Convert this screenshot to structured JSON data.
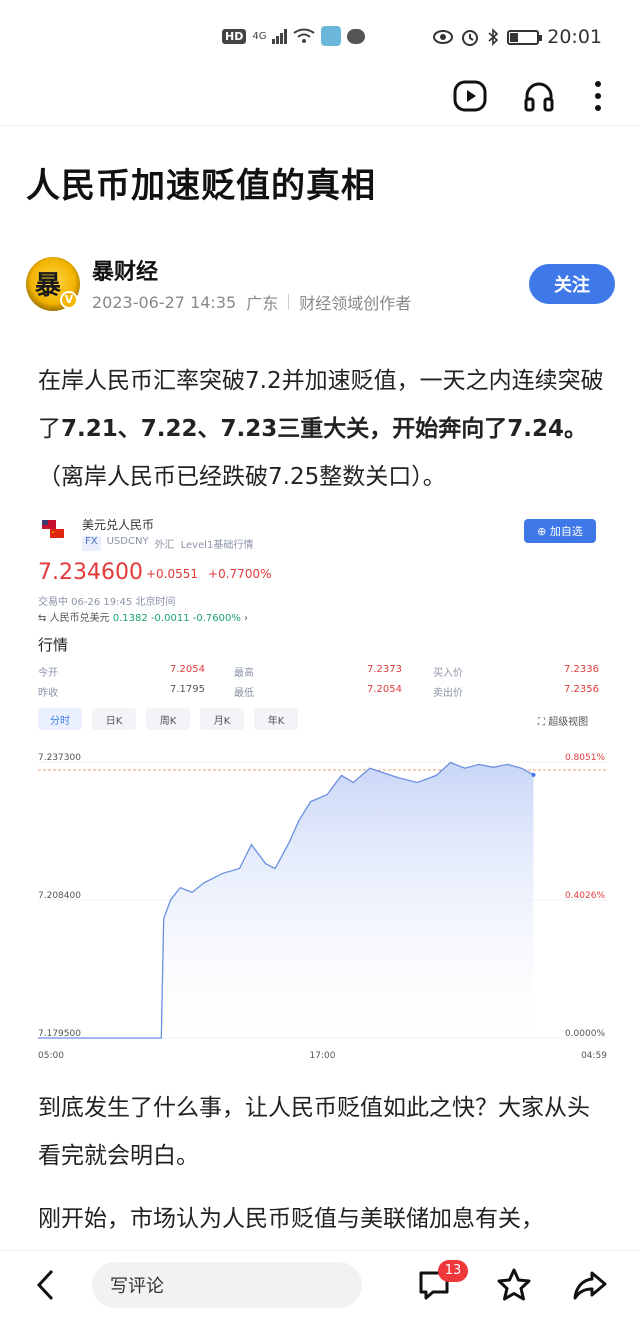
{
  "status_bar": {
    "hd": "HD",
    "network": "4G",
    "time": "20:01"
  },
  "article": {
    "title": "人民币加速贬值的真相",
    "author": {
      "name": "暴财经",
      "avatar_text": "暴",
      "verified_mark": "V",
      "date": "2023-06-27 14:35",
      "region": "广东",
      "role": "财经领域创作者"
    },
    "follow_label": "关注",
    "para1_prefix": "在岸人民币汇率突破7.2并加速贬值，一天之内连续突破了",
    "para1_bold": "7.21、7.22、7.23三重大关，开始奔向了7.24。",
    "para1_suffix": "（离岸人民币已经跌破7.25整数关口）。",
    "para2": "到底发生了什么事，让人民币贬值如此之快？大家从头看完就会明白。",
    "para3": "刚开始，市场认为人民币贬值与美联储加息有关，"
  },
  "quote": {
    "name": "美元兑人民币",
    "market": "FX",
    "code": "USDCNY",
    "type": "外汇",
    "level": "Level1基础行情",
    "add_label": "⊕ 加自选",
    "price": "7.234600",
    "change": "+0.0551",
    "change_pct": "+0.7700%",
    "time": "交易中 06-26 19:45 北京时间",
    "cny_label": "人民币兑美元",
    "cny_price": "0.1382",
    "cny_change": "-0.0011",
    "cny_pct": "-0.7600%",
    "section": "行情",
    "stats": {
      "open_label": "今开",
      "open": "7.2054",
      "high_label": "最高",
      "high": "7.2373",
      "buy_label": "买入价",
      "buy": "7.2336",
      "prev_label": "昨收",
      "prev": "7.1795",
      "low_label": "最低",
      "low": "7.2054",
      "sell_label": "卖出价",
      "sell": "7.2356"
    },
    "tabs": [
      "分时",
      "日K",
      "周K",
      "月K",
      "年K"
    ],
    "active_tab": "分时",
    "full_view": "超级视图"
  },
  "chart_data": {
    "type": "area",
    "title": "",
    "y_ticks": [
      "7.237300",
      "7.208400",
      "7.179500"
    ],
    "right_ticks": [
      "0.8051%",
      "0.4026%",
      "0.0000%"
    ],
    "x_ticks": [
      "05:00",
      "17:00",
      "04:59"
    ],
    "ylim": [
      7.1795,
      7.2373
    ],
    "reference_line": 7.2373,
    "x_range": [
      0,
      24
    ],
    "x": [
      0,
      5.2,
      5.3,
      5.6,
      6.0,
      6.5,
      7.0,
      7.8,
      8.5,
      9.0,
      9.6,
      10.0,
      10.6,
      11.0,
      11.5,
      12.2,
      12.8,
      13.3,
      14.0,
      14.6,
      15.2,
      16.0,
      16.8,
      17.4,
      18.0,
      18.6,
      19.2,
      19.8,
      20.4,
      20.9
    ],
    "y": [
      7.1795,
      7.1795,
      7.2045,
      7.2085,
      7.211,
      7.21,
      7.212,
      7.214,
      7.215,
      7.22,
      7.216,
      7.215,
      7.2205,
      7.225,
      7.229,
      7.2305,
      7.2345,
      7.233,
      7.236,
      7.235,
      7.234,
      7.233,
      7.2345,
      7.2372,
      7.236,
      7.2368,
      7.2362,
      7.2368,
      7.236,
      7.2346
    ]
  },
  "bottom_bar": {
    "comment_placeholder": "写评论",
    "comment_count": "13"
  },
  "colors": {
    "accent": "#3f78e8",
    "up": "#e23a3a",
    "down": "#1aa36a",
    "badge": "#f0373c"
  }
}
